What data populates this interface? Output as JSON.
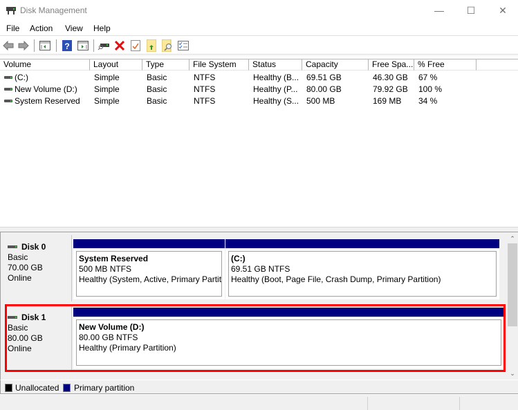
{
  "window": {
    "title": "Disk Management",
    "controls": {
      "minimize": "—",
      "maximize": "☐",
      "close": "✕"
    }
  },
  "menu": [
    "File",
    "Action",
    "View",
    "Help"
  ],
  "toolbar": {
    "buttons": [
      "back-arrow",
      "forward-arrow",
      "show-hide-console-tree",
      "help",
      "show-hide-action-pane",
      "connect-disk",
      "delete",
      "properties",
      "open",
      "explore",
      "settings-list"
    ]
  },
  "volume_list": {
    "columns": [
      "Volume",
      "Layout",
      "Type",
      "File System",
      "Status",
      "Capacity",
      "Free Spa...",
      "% Free"
    ],
    "rows": [
      {
        "volume": " (C:)",
        "layout": "Simple",
        "type": "Basic",
        "fs": "NTFS",
        "status": "Healthy (B...",
        "capacity": "69.51 GB",
        "free": "46.30 GB",
        "pct": "67 %"
      },
      {
        "volume": "New Volume (D:)",
        "layout": "Simple",
        "type": "Basic",
        "fs": "NTFS",
        "status": "Healthy (P...",
        "capacity": "80.00 GB",
        "free": "79.92 GB",
        "pct": "100 %"
      },
      {
        "volume": "System Reserved",
        "layout": "Simple",
        "type": "Basic",
        "fs": "NTFS",
        "status": "Healthy (S...",
        "capacity": "500 MB",
        "free": "169 MB",
        "pct": "34 %"
      }
    ]
  },
  "disks": [
    {
      "name": "Disk 0",
      "type": "Basic",
      "size": "70.00 GB",
      "state": "Online",
      "partitions": [
        {
          "name": "System Reserved",
          "size_fs": "500 MB NTFS",
          "status": "Healthy (System, Active, Primary Partit"
        },
        {
          "name": " (C:)",
          "size_fs": "69.51 GB NTFS",
          "status": "Healthy (Boot, Page File, Crash Dump, Primary Partition)"
        }
      ]
    },
    {
      "name": "Disk 1",
      "type": "Basic",
      "size": "80.00 GB",
      "state": "Online",
      "partitions": [
        {
          "name": "New Volume  (D:)",
          "size_fs": "80.00 GB NTFS",
          "status": "Healthy (Primary Partition)"
        }
      ]
    }
  ],
  "legend": [
    {
      "label": "Unallocated",
      "color": "#000000"
    },
    {
      "label": "Primary partition",
      "color": "#000080"
    }
  ],
  "colors": {
    "primary_partition": "#000080",
    "highlight": "#ff0000"
  }
}
